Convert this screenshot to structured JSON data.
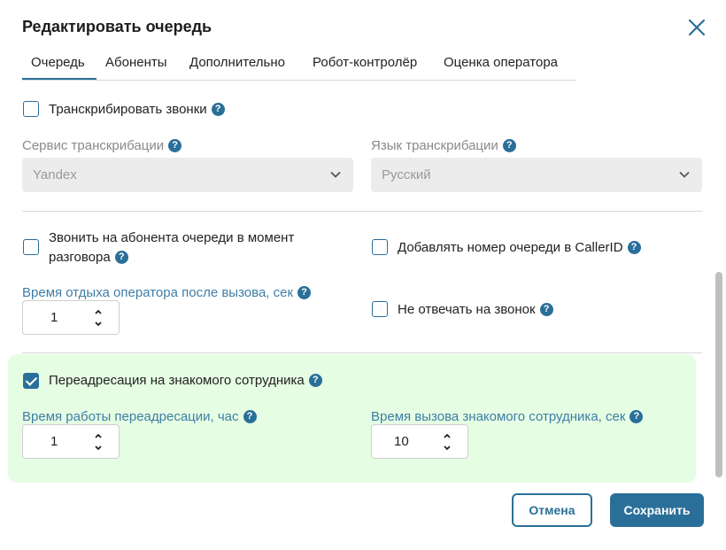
{
  "dialog": {
    "title": "Редактировать очередь",
    "close_icon": "close-icon"
  },
  "tabs": [
    {
      "label": "Очередь",
      "active": true
    },
    {
      "label": "Абоненты",
      "active": false
    },
    {
      "label": "Дополнительно",
      "active": false
    },
    {
      "label": "Робот-контролёр",
      "active": false
    },
    {
      "label": "Оценка оператора",
      "active": false
    }
  ],
  "help_glyph": "?",
  "transcribe": {
    "label": "Транскрибировать звонки",
    "checked": false,
    "service_label": "Сервис транскрибации",
    "service_value": "Yandex",
    "language_label": "Язык транскрибации",
    "language_value": "Русский"
  },
  "options": {
    "call_subscriber_label_1": "Звонить на абонента очереди в момент",
    "call_subscriber_label_2": "разговора",
    "call_subscriber_checked": false,
    "add_queue_number_label": "Добавлять номер очереди в CallerID",
    "add_queue_number_checked": false,
    "rest_time_label": "Время отдыха оператора после вызова, сек",
    "rest_time_value": "1",
    "no_answer_label": "Не отвечать на звонок",
    "no_answer_checked": false
  },
  "redirect": {
    "label": "Переадресация на знакомого сотрудника",
    "checked": true,
    "work_time_label": "Время работы переадресации, час",
    "work_time_value": "1",
    "call_time_label": "Время вызова знакомого сотрудника, сек",
    "call_time_value": "10"
  },
  "buttons": {
    "cancel": "Отмена",
    "save": "Сохранить"
  },
  "colors": {
    "accent": "#2a6f99",
    "highlight_bg": "#e5fde3",
    "field_label_blue": "#3f7ea6"
  }
}
